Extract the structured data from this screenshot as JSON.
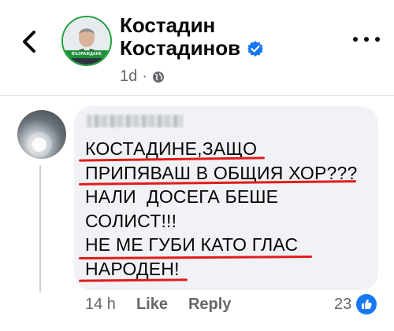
{
  "header": {
    "author_line1": "Костадин",
    "author_line2": "Костадинов",
    "timestamp": "1d",
    "separator": "·",
    "avatar_badge_text": "ВЪЗРАЖДАНЕ",
    "verified_color": "#1877f2"
  },
  "comment": {
    "lines": [
      "КОСТАДИНЕ,ЗАЩО",
      "ПРИПЯВАШ В ОБЩИЯ ХОР???",
      "НАЛИ  ДОСЕГА БЕШЕ",
      "СОЛИСТ!!!",
      "НЕ МЕ ГУБИ КАТО ГЛАС",
      "НАРОДЕН!"
    ],
    "time": "14 h",
    "like_label": "Like",
    "reply_label": "Reply",
    "reaction_count": "23",
    "underline_color": "#e21b1b"
  }
}
